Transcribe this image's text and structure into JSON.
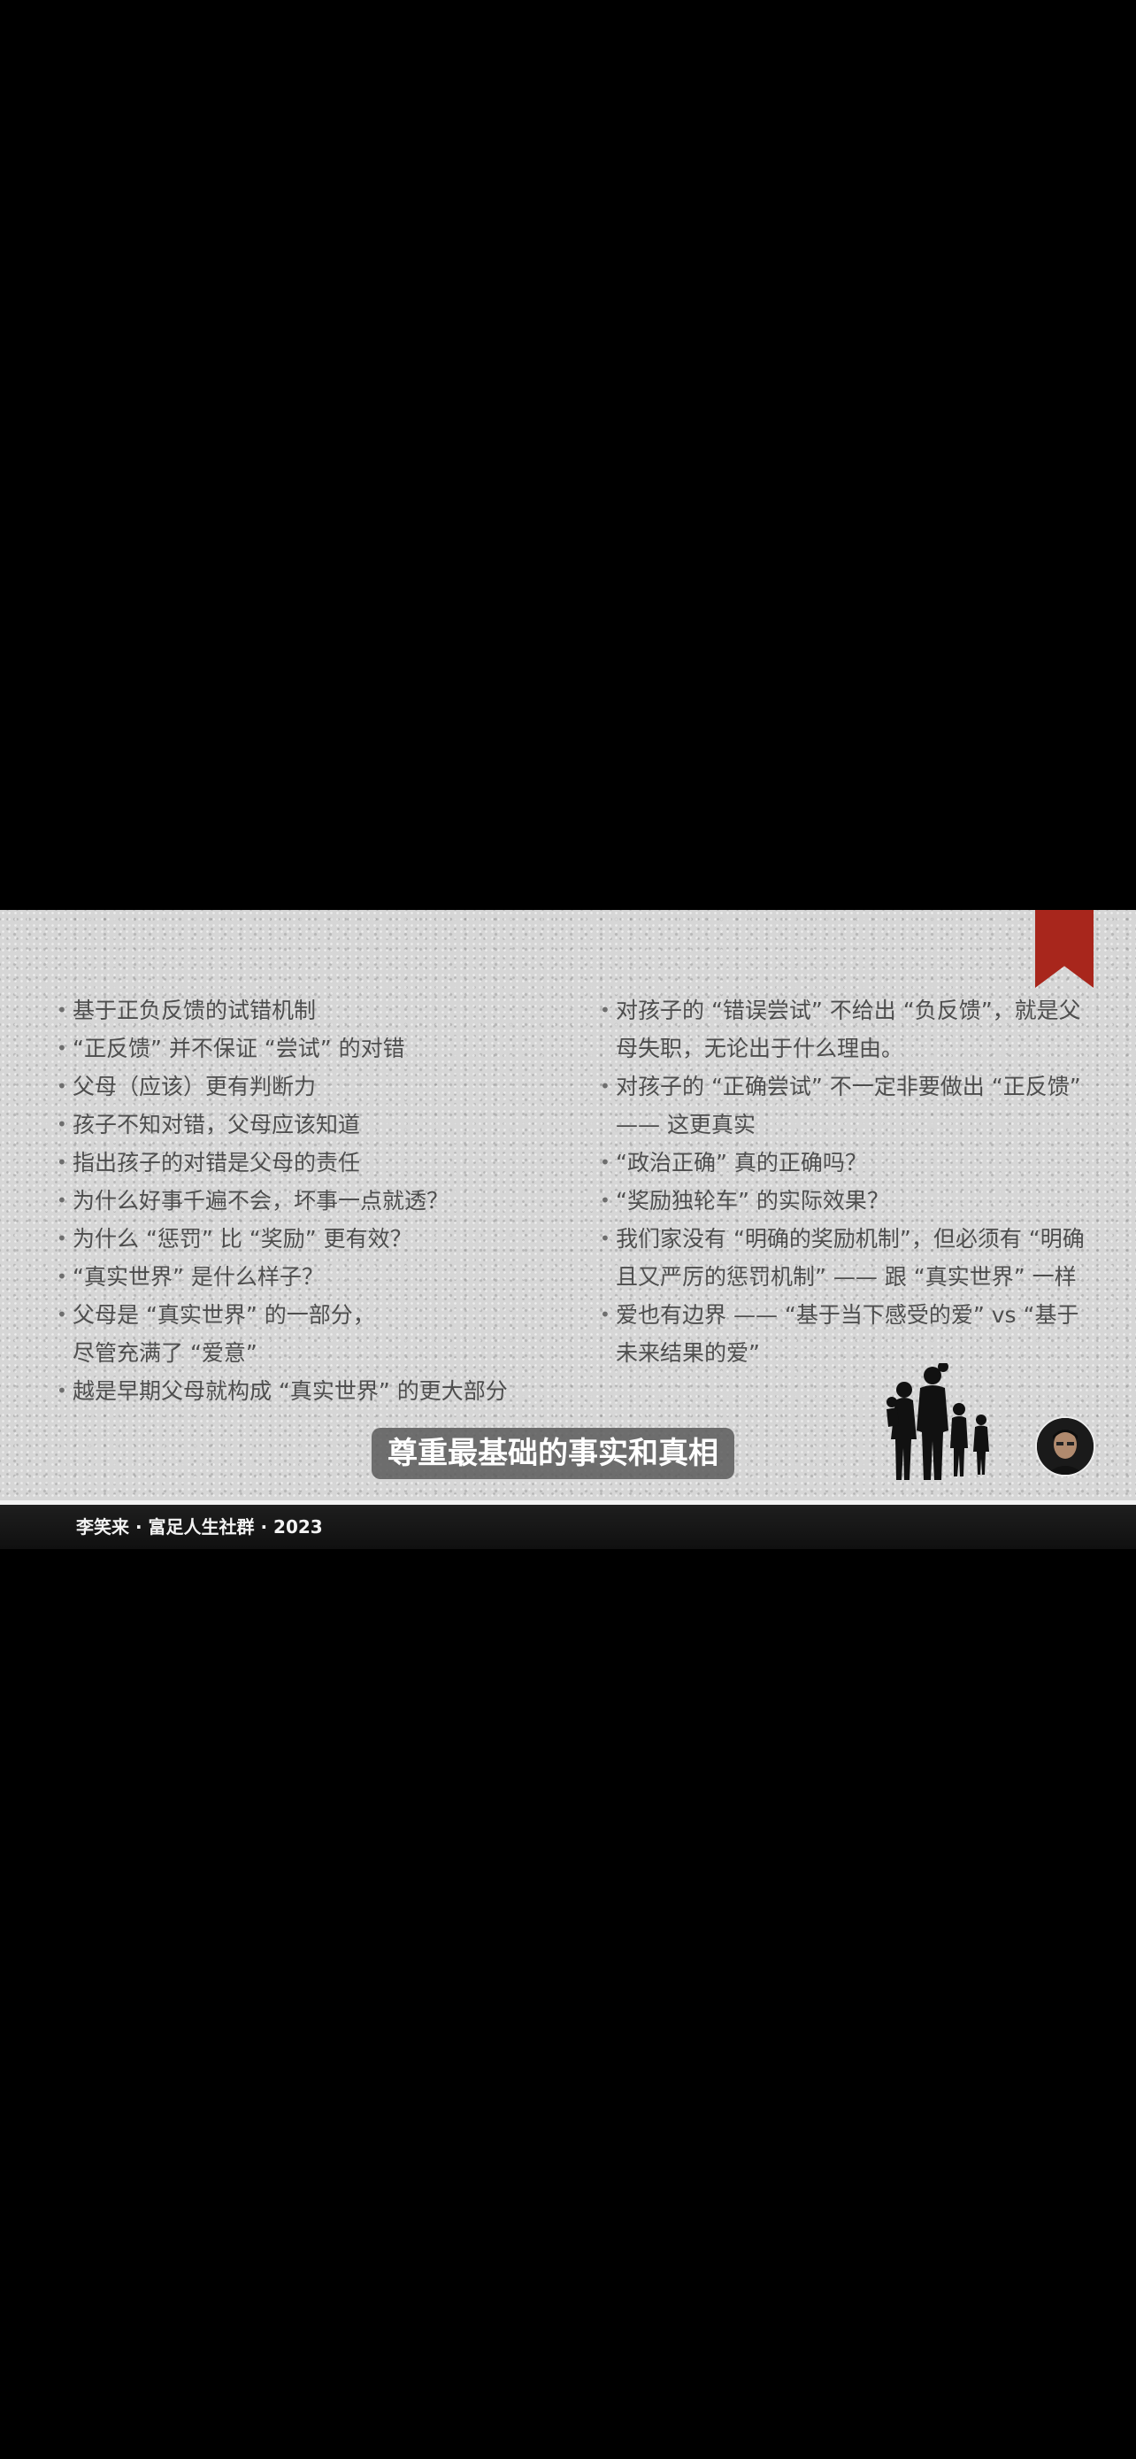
{
  "slide": {
    "left_column": [
      {
        "lines": [
          "基于正负反馈的试错机制"
        ]
      },
      {
        "lines": [
          "“正反馈” 并不保证 “尝试” 的对错"
        ]
      },
      {
        "lines": [
          "父母（应该）更有判断力"
        ]
      },
      {
        "lines": [
          "孩子不知对错，父母应该知道"
        ]
      },
      {
        "lines": [
          "指出孩子的对错是父母的责任"
        ]
      },
      {
        "lines": [
          "为什么好事千遍不会，坏事一点就透？"
        ]
      },
      {
        "lines": [
          "为什么 “惩罚” 比 “奖励” 更有效？"
        ]
      },
      {
        "lines": [
          "“真实世界” 是什么样子？"
        ]
      },
      {
        "lines": [
          "父母是 “真实世界” 的一部分，",
          "尽管充满了 “爱意”"
        ]
      },
      {
        "lines": [
          "越是早期父母就构成 “真实世界” 的更大部分"
        ]
      }
    ],
    "right_column": [
      {
        "lines": [
          "对孩子的 “错误尝试” 不给出 “负反馈”，就是父",
          "母失职，无论出于什么理由。"
        ]
      },
      {
        "lines": [
          "对孩子的 “正确尝试” 不一定非要做出 “正反馈”",
          "—— 这更真实"
        ]
      },
      {
        "lines": [
          "“政治正确” 真的正确吗？"
        ]
      },
      {
        "lines": [
          "“奖励独轮车” 的实际效果？"
        ]
      },
      {
        "lines": [
          "我们家没有 “明确的奖励机制”，但必须有 “明确",
          "且又严厉的惩罚机制” —— 跟 “真实世界” 一样"
        ]
      },
      {
        "lines": [
          "爱也有边界 —— “基于当下感受的爱” vs “基于",
          "未来结果的爱”"
        ]
      }
    ],
    "caption": "尊重最基础的事实和真相",
    "accent_color": "#a8261c",
    "icons": [
      "bookmark-ribbon-icon",
      "family-silhouette-icon",
      "presenter-avatar-icon"
    ]
  },
  "footer": {
    "text": "李笑来 · 富足人生社群 · 2023"
  }
}
